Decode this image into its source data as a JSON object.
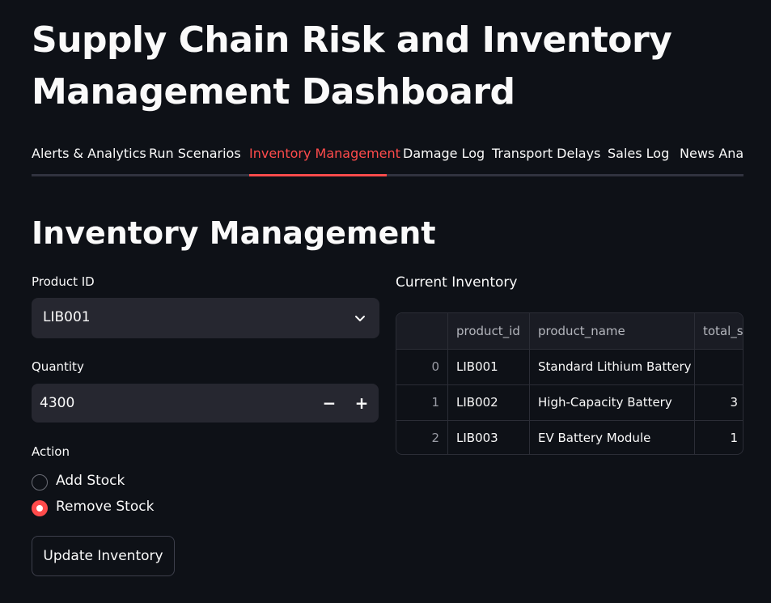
{
  "page": {
    "title": "Supply Chain Risk and Inventory Management Dashboard"
  },
  "tabs": [
    {
      "label": "Alerts & Analytics"
    },
    {
      "label": "Run Scenarios"
    },
    {
      "label": "Inventory Management",
      "active": true
    },
    {
      "label": "Damage Log"
    },
    {
      "label": "Transport Delays"
    },
    {
      "label": "Sales Log"
    },
    {
      "label": "News Analy"
    }
  ],
  "section": {
    "title": "Inventory Management"
  },
  "form": {
    "product_label": "Product ID",
    "product_value": "LIB001",
    "quantity_label": "Quantity",
    "quantity_value": "4300",
    "minus": "−",
    "plus": "+",
    "action_label": "Action",
    "options": [
      {
        "label": "Add Stock",
        "selected": false
      },
      {
        "label": "Remove Stock",
        "selected": true
      }
    ],
    "submit_label": "Update Inventory"
  },
  "inventory": {
    "title": "Current Inventory",
    "columns": [
      "",
      "product_id",
      "product_name",
      "total_s"
    ],
    "rows": [
      {
        "index": "0",
        "product_id": "LIB001",
        "product_name": "Standard Lithium Battery",
        "total": ""
      },
      {
        "index": "1",
        "product_id": "LIB002",
        "product_name": "High-Capacity Battery",
        "total": "3"
      },
      {
        "index": "2",
        "product_id": "LIB003",
        "product_name": "EV Battery Module",
        "total": "1"
      }
    ]
  },
  "colors": {
    "background": "#0e1117",
    "accent": "#ff4b4b",
    "input_bg": "#262730",
    "text": "#fafafa"
  },
  "icons": {
    "select": "chevron-down-icon",
    "radio_on": "radio-selected-icon",
    "radio_off": "radio-unselected-icon"
  }
}
